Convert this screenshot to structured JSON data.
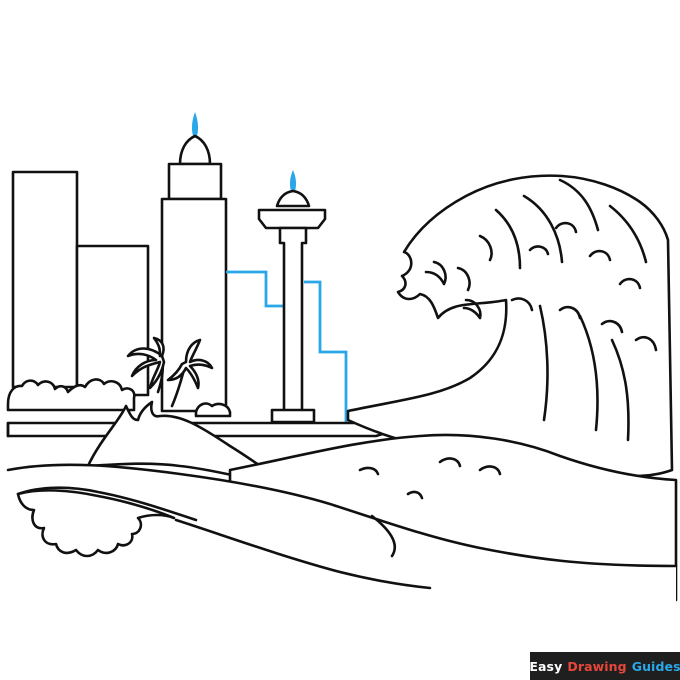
{
  "branding": {
    "word_easy": "Easy",
    "word_drawing": "Drawing",
    "word_guides": "Guides",
    "color_easy": "#ffffff",
    "color_drawing": "#e8463a",
    "color_guides": "#2aa7e8",
    "badge_background": "#1f1f1f"
  },
  "colors": {
    "ink": "#111111",
    "guide_lines": "#2aa7e8",
    "background": "#ffffff"
  },
  "icons": [
    "skyscraper",
    "domed-tower",
    "observation-tower",
    "palm-trees",
    "tidal-wave",
    "waves"
  ]
}
